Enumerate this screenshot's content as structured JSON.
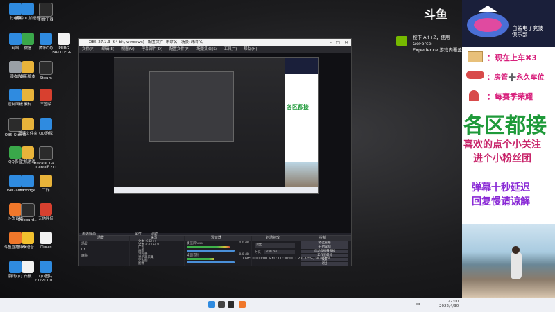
{
  "brand": {
    "douyu_logo": "斗鱼"
  },
  "desktop_icons": [
    {
      "label": "此电脑",
      "color": "#3a7bd5"
    },
    {
      "label": "网易UU加速器",
      "color": "#2f8be0"
    },
    {
      "label": "迅雷下载",
      "color": "#333333"
    },
    {
      "label": "网络",
      "color": "#2f8be0"
    },
    {
      "label": "微信",
      "color": "#3aa84a"
    },
    {
      "label": "腾讯QQ",
      "color": "#2f8be0"
    },
    {
      "label": "PUBG BATTLEGR...",
      "color": "#f2f2f2"
    },
    {
      "label": "回收站",
      "color": "#9aa0a6"
    },
    {
      "label": "最新版本",
      "color": "#e8b33a"
    },
    {
      "label": "Steam",
      "color": "#1b2838"
    },
    {
      "label": "控制面板",
      "color": "#2f8be0"
    },
    {
      "label": "素材",
      "color": "#e8b33a"
    },
    {
      "label": "三国杀",
      "color": "#d8402f"
    },
    {
      "label": "OBS Studio",
      "color": "#2b2b2b"
    },
    {
      "label": "新建文件夹",
      "color": "#e8b33a"
    },
    {
      "label": "QQ游戏",
      "color": "#2f8be0"
    },
    {
      "label": "QQ影音",
      "color": "#3aa84a"
    },
    {
      "label": "主机游戏",
      "color": "#e8b33a"
    },
    {
      "label": "Hecate_Ga... Center 2.0",
      "color": "#2b2b2b"
    },
    {
      "label": "WeGame",
      "color": "#2f8be0"
    },
    {
      "label": "moodge",
      "color": "#2f8be0"
    },
    {
      "label": "工作",
      "color": "#e8b33a"
    },
    {
      "label": "斗鱼直播",
      "color": "#f0772a"
    },
    {
      "label": "Onboard...",
      "color": "#2b2b2b"
    },
    {
      "label": "无他伴侣",
      "color": "#d8402f"
    },
    {
      "label": "斗鱼直播伴侣",
      "color": "#f0772a"
    },
    {
      "label": "YY语音",
      "color": "#f2c12e"
    },
    {
      "label": "iTunes",
      "color": "#f2f2f2"
    },
    {
      "label": "腾讯QQ",
      "color": "#2f8be0"
    },
    {
      "label": "白板",
      "color": "#f2f2f2"
    },
    {
      "label": "QQ图片 20220110...",
      "color": "#2f8be0"
    }
  ],
  "obs": {
    "title": "OBS 27.1.3 (64 bit, windows) - 配置文件: 未命名 - 场景: 未命名",
    "menu": [
      "文件(F)",
      "编辑(E)",
      "视图(V)",
      "停靠部件(D)",
      "配置文件(P)",
      "场景集合(S)",
      "工具(T)",
      "帮助(H)"
    ],
    "status_text": "未选择源",
    "properties_btn": "属性",
    "filters_btn": "滤镜",
    "docks": {
      "scenes": {
        "title": "场景",
        "items": [
          "场景",
          "CF",
          "麻将"
        ]
      },
      "sources": {
        "title": "来源",
        "items": [
          "文本 (GDI+)",
          "文本 (GDI+) 4",
          "广告",
          "画面",
          "浏览器",
          "显示器采集",
          "个人图",
          "图像"
        ]
      },
      "mixer": {
        "title": "混音器",
        "tracks": [
          {
            "name": "麦克风/Aux",
            "db": "0.0 dB"
          },
          {
            "name": "桌面音频",
            "db": "0.0 dB"
          }
        ]
      },
      "transitions": {
        "title": "转场特效",
        "type": "淡出",
        "duration_label": "时长",
        "duration": "300 ms"
      },
      "controls": {
        "title": "控制",
        "buttons": [
          "停止直播",
          "开始录制",
          "启动虚拟摄像机",
          "工作室模式",
          "设置",
          "退出"
        ]
      }
    },
    "statusbar": {
      "live": "LIVE: 00:00:00",
      "rec": "REC: 00:00:00",
      "cpu": "CPU: 3.5%, 30.00 fps"
    }
  },
  "nvidia_toast": {
    "text_line1": "按下 Alt+Z，使用 GeForce",
    "text_line2": "Experience 游戏内覆盖"
  },
  "panel": {
    "club_name_line1": "白鲨电子竞技",
    "club_name_line2": "俱乐部",
    "promo": [
      {
        "text": "：现在上车✖3",
        "color": "#d8207c"
      },
      {
        "text": "：房管➕永久车位",
        "color": "#d8207c"
      },
      {
        "text": "：每赛季荣耀",
        "color": "#d8207c"
      }
    ],
    "headline": "各区都接",
    "headline_color": "#1f9a3a",
    "subline1": "喜欢的点个小关注",
    "subline2": "进个小粉丝团",
    "notice1": "弹幕十秒延迟",
    "notice2": "回复慢请谅解",
    "sub_color": "#c8246a",
    "notice_color": "#8a2ad6"
  },
  "taskbar": {
    "time": "22:00",
    "date": "2022/4/30",
    "lang": "中"
  }
}
